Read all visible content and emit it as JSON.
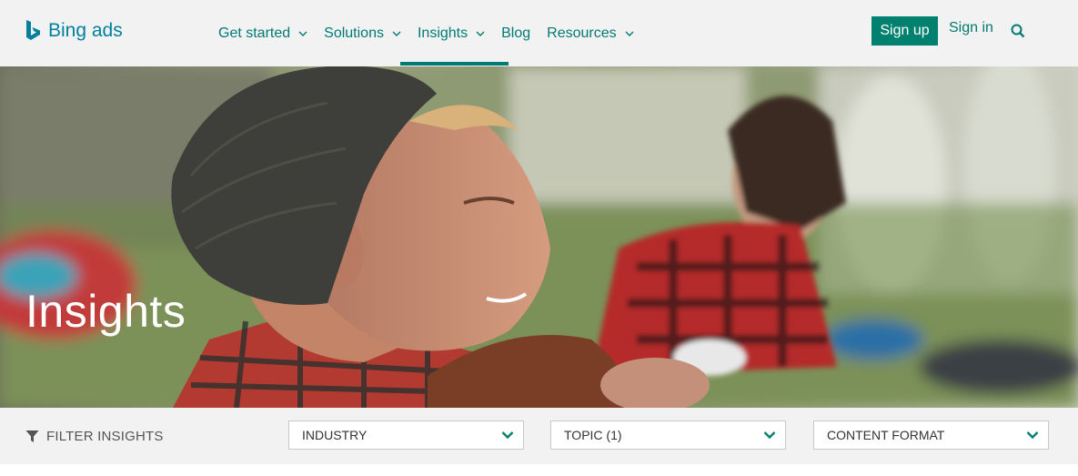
{
  "header": {
    "logo": {
      "brand": "Bing",
      "suffix": " ads"
    },
    "nav": [
      {
        "label": "Get started",
        "has_menu": true
      },
      {
        "label": "Solutions",
        "has_menu": true
      },
      {
        "label": "Insights",
        "has_menu": true,
        "active": true
      },
      {
        "label": "Blog",
        "has_menu": false
      },
      {
        "label": "Resources",
        "has_menu": true
      }
    ],
    "signup_label": "Sign up",
    "signin_label": "Sign in",
    "search_icon": "search-icon"
  },
  "hero": {
    "title": "Insights"
  },
  "filter": {
    "label": "FILTER INSIGHTS",
    "icon": "funnel-icon",
    "dropdowns": [
      {
        "value": "INDUSTRY"
      },
      {
        "value": "TOPIC (1)"
      },
      {
        "value": "CONTENT FORMAT"
      }
    ]
  },
  "colors": {
    "accent": "#007a73",
    "button": "#00806f",
    "header_bg": "#f2f2f2"
  }
}
